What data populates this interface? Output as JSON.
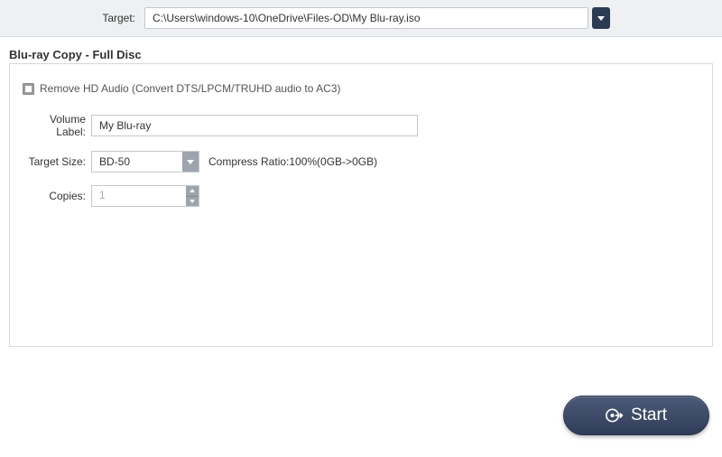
{
  "target": {
    "label": "Target:",
    "value": "C:\\Users\\windows-10\\OneDrive\\Files-OD\\My Blu-ray.iso"
  },
  "section_title": "Blu-ray Copy - Full Disc",
  "remove_hd_audio": {
    "label": "Remove HD Audio (Convert DTS/LPCM/TRUHD audio to AC3)"
  },
  "volume": {
    "label": "Volume Label:",
    "value": "My Blu-ray"
  },
  "target_size": {
    "label": "Target Size:",
    "selected": "BD-50",
    "compress_text": "Compress Ratio:100%(0GB->0GB)"
  },
  "copies": {
    "label": "Copies:",
    "value": "1"
  },
  "start_button": {
    "label": "Start"
  }
}
